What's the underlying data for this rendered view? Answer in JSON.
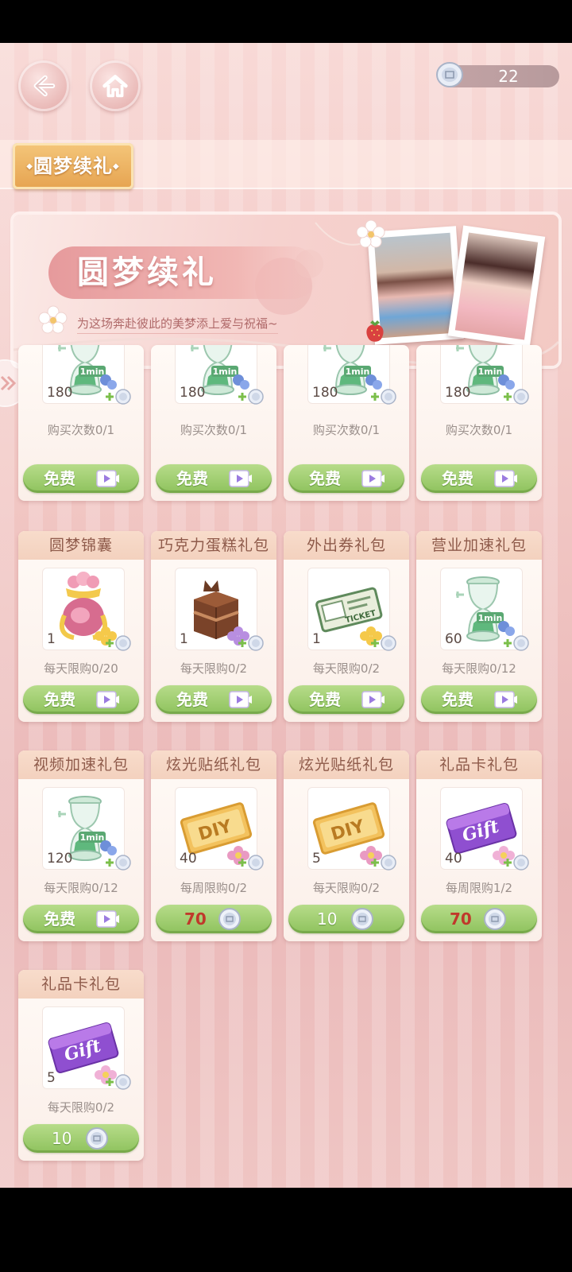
{
  "currency": {
    "amount": "22",
    "icon": "silver-coin-icon"
  },
  "nav": {
    "back_icon": "back-arrow-icon",
    "home_icon": "home-icon"
  },
  "tabs": [
    {
      "label": "圆梦续礼",
      "active": true
    }
  ],
  "banner": {
    "title": "圆梦续礼",
    "subtitle": "为这场奔赴彼此的美梦添上爱与祝福~"
  },
  "partial_row": [
    {
      "qty": "180",
      "limit": "购买次数0/1",
      "button": {
        "type": "free",
        "label": "免费"
      },
      "icon": "hourglass-icon"
    },
    {
      "qty": "180",
      "limit": "购买次数0/1",
      "button": {
        "type": "free",
        "label": "免费"
      },
      "icon": "hourglass-icon"
    },
    {
      "qty": "180",
      "limit": "购买次数0/1",
      "button": {
        "type": "free",
        "label": "免费"
      },
      "icon": "hourglass-icon"
    },
    {
      "qty": "180",
      "limit": "购买次数0/1",
      "button": {
        "type": "free",
        "label": "免费"
      },
      "icon": "hourglass-icon"
    }
  ],
  "packs": [
    {
      "title": "圆梦锦囊",
      "qty": "1",
      "limit": "每天限购0/20",
      "button": {
        "type": "free",
        "label": "免费"
      },
      "icon": "pouch-icon"
    },
    {
      "title": "巧克力蛋糕礼包",
      "qty": "1",
      "limit": "每天限购0/2",
      "button": {
        "type": "free",
        "label": "免费"
      },
      "icon": "chocolate-cake-icon"
    },
    {
      "title": "外出券礼包",
      "qty": "1",
      "limit": "每天限购0/2",
      "button": {
        "type": "free",
        "label": "免费"
      },
      "icon": "ticket-icon"
    },
    {
      "title": "营业加速礼包",
      "qty": "60",
      "limit": "每天限购0/12",
      "button": {
        "type": "free",
        "label": "免费"
      },
      "icon": "hourglass-icon"
    },
    {
      "title": "视频加速礼包",
      "qty": "120",
      "limit": "每天限购0/12",
      "button": {
        "type": "free",
        "label": "免费"
      },
      "icon": "hourglass-icon"
    },
    {
      "title": "炫光贴纸礼包",
      "qty": "40",
      "limit": "每周限购0/2",
      "button": {
        "type": "price",
        "price": "70",
        "price_color": "#c0392b"
      },
      "icon": "diy-sticker-icon"
    },
    {
      "title": "炫光贴纸礼包",
      "qty": "5",
      "limit": "每天限购0/2",
      "button": {
        "type": "price",
        "price": "10",
        "price_color": "#ffffff"
      },
      "icon": "diy-sticker-icon"
    },
    {
      "title": "礼品卡礼包",
      "qty": "40",
      "limit": "每周限购1/2",
      "button": {
        "type": "price",
        "price": "70",
        "price_color": "#c0392b"
      },
      "icon": "gift-card-icon"
    },
    {
      "title": "礼品卡礼包",
      "qty": "5",
      "limit": "每天限购0/2",
      "button": {
        "type": "price",
        "price": "10",
        "price_color": "#ffffff"
      },
      "icon": "gift-card-icon"
    }
  ],
  "item_marks": {
    "hourglass": "1min",
    "ticket": "TICKET",
    "sticker": "DIY",
    "giftcard": "Gift"
  },
  "colors": {
    "free_button": "#9ccc6a",
    "tab_active": "#eeb160",
    "card_header": "#f6d8c6"
  }
}
